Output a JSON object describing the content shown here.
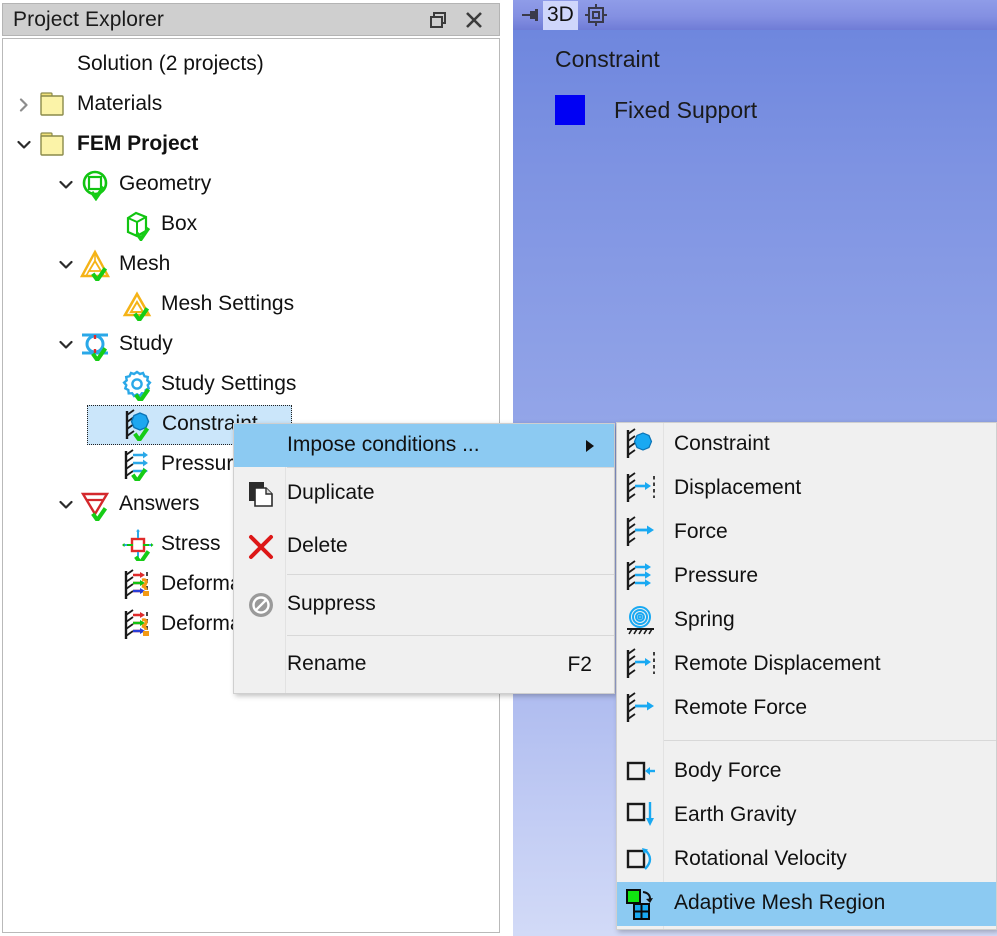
{
  "explorer": {
    "title": "Project Explorer",
    "buttons": [
      {
        "name": "restore-window-button",
        "label": "Restore"
      },
      {
        "name": "close-panel-button",
        "label": "Close"
      }
    ],
    "tree": [
      {
        "label": "Solution (2 projects)",
        "icon": "none",
        "indent": 0,
        "twist": "none",
        "bold": false,
        "selected": false
      },
      {
        "label": "Materials",
        "icon": "folder",
        "indent": 1,
        "twist": "collapsed",
        "bold": false,
        "selected": false
      },
      {
        "label": "FEM Project",
        "icon": "folder",
        "indent": 1,
        "twist": "expanded",
        "bold": true,
        "selected": false
      },
      {
        "label": "Geometry",
        "icon": "geometry",
        "indent": 2,
        "twist": "expanded",
        "bold": false,
        "selected": false
      },
      {
        "label": "Box",
        "icon": "box",
        "indent": 3,
        "twist": "none",
        "bold": false,
        "selected": false
      },
      {
        "label": "Mesh",
        "icon": "mesh",
        "indent": 2,
        "twist": "expanded",
        "bold": false,
        "selected": false
      },
      {
        "label": "Mesh Settings",
        "icon": "mesh-settings",
        "indent": 3,
        "twist": "none",
        "bold": false,
        "selected": false
      },
      {
        "label": "Study",
        "icon": "study",
        "indent": 2,
        "twist": "expanded",
        "bold": false,
        "selected": false
      },
      {
        "label": "Study Settings",
        "icon": "study-settings",
        "indent": 3,
        "twist": "none",
        "bold": false,
        "selected": false
      },
      {
        "label": "Constraint",
        "icon": "constraint",
        "indent": 3,
        "twist": "none",
        "bold": false,
        "selected": true
      },
      {
        "label": "Pressure",
        "icon": "pressure",
        "indent": 3,
        "twist": "none",
        "bold": false,
        "selected": false
      },
      {
        "label": "Answers",
        "icon": "answers",
        "indent": 2,
        "twist": "expanded",
        "bold": false,
        "selected": false
      },
      {
        "label": "Stress",
        "icon": "stress",
        "indent": 3,
        "twist": "none",
        "bold": false,
        "selected": false
      },
      {
        "label": "Deformation",
        "icon": "deformation",
        "indent": 3,
        "twist": "none",
        "bold": false,
        "selected": false
      },
      {
        "label": "Deformation",
        "icon": "deformation",
        "indent": 3,
        "twist": "none",
        "bold": false,
        "selected": false
      }
    ]
  },
  "viewport": {
    "pin_icon": "pin-icon",
    "tab_label": "3D",
    "origin_icon": "origin-marker-icon",
    "legend_title": "Constraint",
    "legend_item_label": "Fixed Support",
    "legend_swatch_color": "#0000f4",
    "background_top_color": "#6b84dd",
    "background_bottom_color": "#d2daf7",
    "tabbar_color": "#8490e2",
    "active_tab_color": "#cfd6fb"
  },
  "context_menu": {
    "highlight_color": "#8ccaf2",
    "background_color": "#f0f0f0",
    "items": [
      {
        "label": "Impose conditions ...",
        "icon": "none",
        "accel": "",
        "submenu": true,
        "highlight": true
      },
      {
        "label": "Duplicate",
        "icon": "duplicate-icon",
        "accel": "",
        "submenu": false,
        "highlight": false
      },
      {
        "label": "Delete",
        "icon": "delete-icon",
        "accel": "",
        "submenu": false,
        "highlight": false
      },
      {
        "label": "Suppress",
        "icon": "suppress-icon",
        "accel": "",
        "submenu": false,
        "highlight": false
      },
      {
        "label": "Rename",
        "icon": "none",
        "accel": "F2",
        "submenu": false,
        "highlight": false
      }
    ]
  },
  "submenu": {
    "highlight_color": "#8ccaf2",
    "items": [
      {
        "label": "Constraint",
        "icon": "constraint-icon",
        "highlight": false
      },
      {
        "label": "Displacement",
        "icon": "displacement-icon",
        "highlight": false
      },
      {
        "label": "Force",
        "icon": "force-icon",
        "highlight": false
      },
      {
        "label": "Pressure",
        "icon": "pressure-icon",
        "highlight": false
      },
      {
        "label": "Spring",
        "icon": "spring-icon",
        "highlight": false
      },
      {
        "label": "Remote Displacement",
        "icon": "remote-displacement-icon",
        "highlight": false
      },
      {
        "label": "Remote Force",
        "icon": "remote-force-icon",
        "highlight": false
      },
      {
        "label": "Body Force",
        "icon": "body-force-icon",
        "highlight": false
      },
      {
        "label": "Earth Gravity",
        "icon": "earth-gravity-icon",
        "highlight": false
      },
      {
        "label": "Rotational Velocity",
        "icon": "rotational-velocity-icon",
        "highlight": false
      },
      {
        "label": "Adaptive Mesh Region",
        "icon": "adaptive-mesh-icon",
        "highlight": true
      }
    ]
  }
}
